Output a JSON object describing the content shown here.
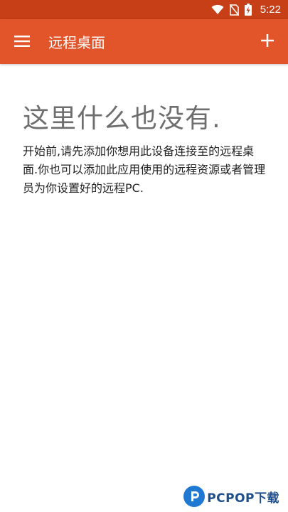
{
  "status_bar": {
    "time": "5:22",
    "icons": [
      "wifi-icon",
      "no-sim-icon",
      "battery-charging-icon"
    ]
  },
  "app_bar": {
    "title": "远程桌面",
    "menu_icon": "hamburger-menu-icon",
    "add_icon": "plus-icon"
  },
  "empty_state": {
    "heading": "这里什么也没有.",
    "body": "开始前,请先添加你想用此设备连接至的远程桌面.你也可以添加此应用使用的远程资源或者管理员为你设置好的远程PC."
  },
  "watermark": {
    "text": "PCPOP下载"
  },
  "colors": {
    "status_bar": "#c63f17",
    "app_bar": "#e2542a",
    "heading_text": "#6e6e6e",
    "body_text": "#222222"
  }
}
